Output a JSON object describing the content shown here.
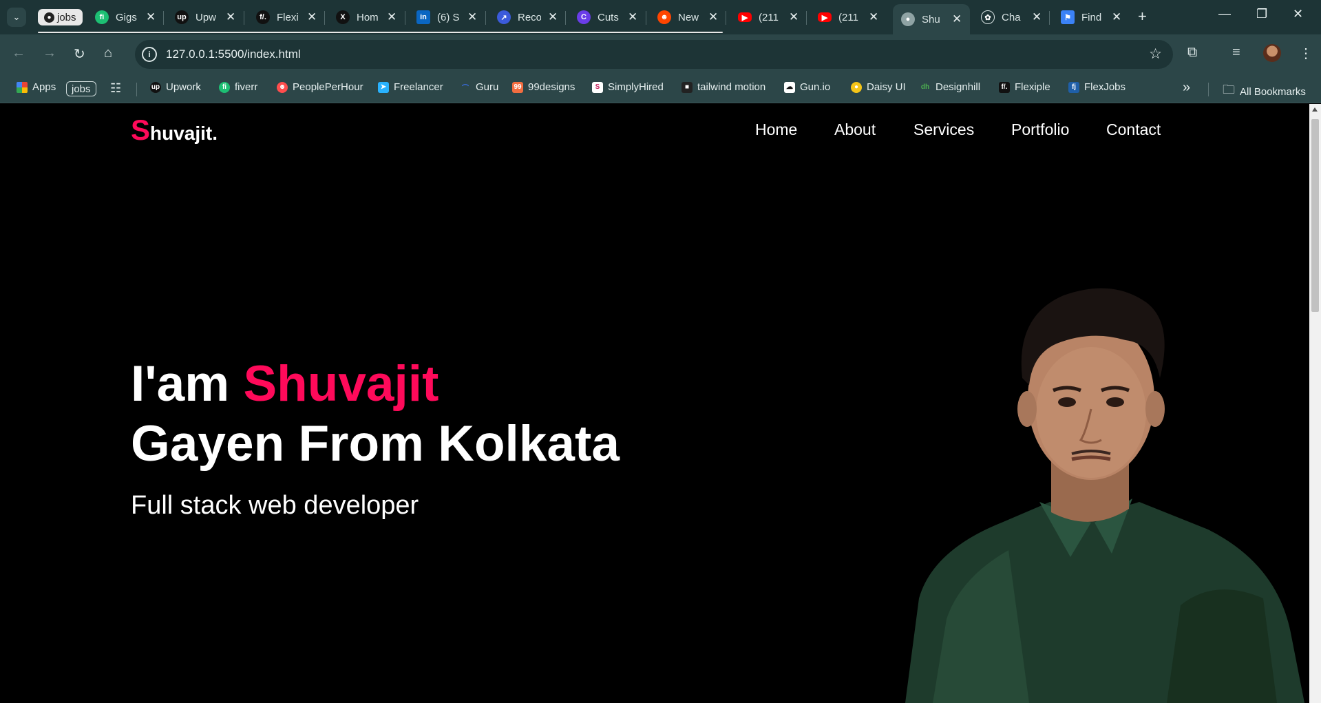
{
  "browser": {
    "tab_group": "jobs",
    "tabs": [
      {
        "title": "Gigs",
        "icon": "fiverr-icon",
        "color": "#1dbf73"
      },
      {
        "title": "Upw",
        "icon": "upwork-icon",
        "color": "#111111"
      },
      {
        "title": "Flexi",
        "icon": "flexiple-icon",
        "color": "#111111"
      },
      {
        "title": "Hom",
        "icon": "x-icon",
        "color": "#111111"
      },
      {
        "title": "(6) S",
        "icon": "linkedin-icon",
        "color": "#0a66c2"
      },
      {
        "title": "Reco",
        "icon": "upwork-blue-icon",
        "color": "#3b5bdb"
      },
      {
        "title": "Cuts",
        "icon": "cuts-icon",
        "color": "#6a3de8"
      },
      {
        "title": "New",
        "icon": "reddit-icon",
        "color": "#ff4500"
      },
      {
        "title": "(211",
        "icon": "youtube-icon",
        "color": "#ff0000"
      },
      {
        "title": "(211",
        "icon": "youtube-icon",
        "color": "#ff0000"
      },
      {
        "title": "Shu",
        "icon": "globe-icon",
        "color": "#8fa3a4"
      },
      {
        "title": "Cha",
        "icon": "chatgpt-icon",
        "color": "#d9e4e4"
      },
      {
        "title": "Find",
        "icon": "flag-icon",
        "color": "#3b82f6"
      }
    ],
    "url": "127.0.0.1:5500/index.html",
    "bookmarks": {
      "apps_label": "Apps",
      "jobs_label": "jobs",
      "items": [
        {
          "label": "Upwork",
          "icon": "upwork-icon",
          "color": "#111111"
        },
        {
          "label": "fiverr",
          "icon": "fiverr-icon",
          "color": "#1dbf73"
        },
        {
          "label": "PeoplePerHour",
          "icon": "pph-icon",
          "color": "#ff4d4d"
        },
        {
          "label": "Freelancer",
          "icon": "freelancer-icon",
          "color": "#29b2fe"
        },
        {
          "label": "Guru",
          "icon": "guru-icon",
          "color": "#3a6ee8"
        },
        {
          "label": "99designs",
          "icon": "99designs-icon",
          "color": "#f26d40"
        },
        {
          "label": "SimplyHired",
          "icon": "simplyhired-icon",
          "color": "#c5235f"
        },
        {
          "label": "tailwind motion",
          "icon": "tailwind-motion-icon",
          "color": "#222222"
        },
        {
          "label": "Gun.io",
          "icon": "gunio-icon",
          "color": "#111111"
        },
        {
          "label": "Daisy UI",
          "icon": "daisyui-icon",
          "color": "#f5c518"
        },
        {
          "label": "Designhill",
          "icon": "designhill-icon",
          "color": "#4caf50"
        },
        {
          "label": "Flexiple",
          "icon": "flexiple-icon",
          "color": "#111111"
        },
        {
          "label": "FlexJobs",
          "icon": "flexjobs-icon",
          "color": "#1f5fa8"
        }
      ],
      "all_bookmarks_label": "All Bookmarks"
    }
  },
  "site": {
    "logo_initial": "S",
    "logo_rest": "huvajit.",
    "nav": [
      "Home",
      "About",
      "Services",
      "Portfolio",
      "Contact"
    ],
    "hero": {
      "greeting": "I'am",
      "first_name": "Shuvajit",
      "line2": "Gayen From Kolkata",
      "subtitle": "Full stack web developer"
    },
    "accent_color": "#ff0a5a"
  }
}
